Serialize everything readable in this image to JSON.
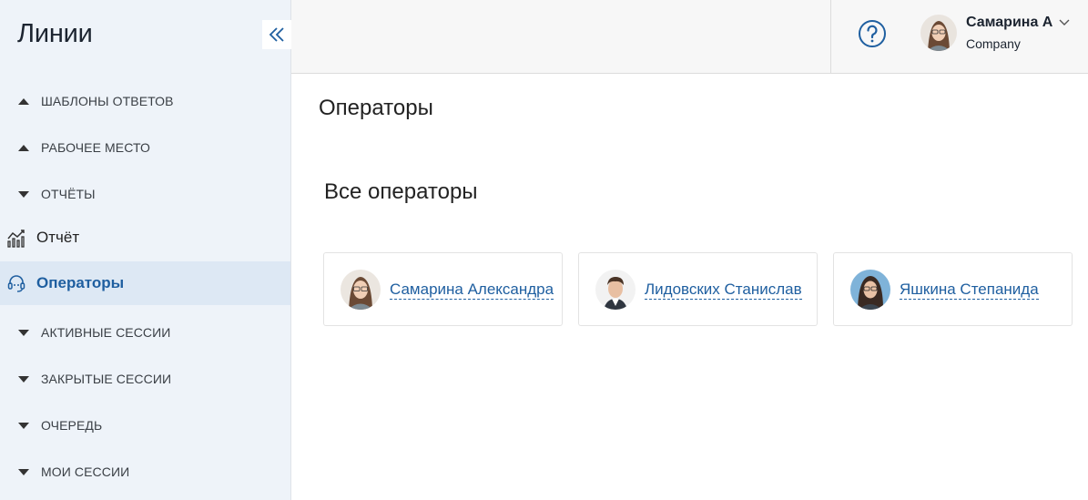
{
  "sidebar": {
    "title": "Линии",
    "sections": [
      {
        "label": "ШАБЛОНЫ ОТВЕТОВ",
        "state": "up"
      },
      {
        "label": "РАБОЧЕЕ МЕСТО",
        "state": "up"
      },
      {
        "label": "ОТЧЁТЫ",
        "state": "down"
      }
    ],
    "items": [
      {
        "label": "Отчёт",
        "icon": "chart-icon"
      },
      {
        "label": "Операторы",
        "icon": "headset-icon",
        "active": true
      }
    ],
    "sections_after": [
      {
        "label": "АКТИВНЫЕ СЕССИИ",
        "state": "down"
      },
      {
        "label": "ЗАКРЫТЫЕ СЕССИИ",
        "state": "down"
      },
      {
        "label": "ОЧЕРЕДЬ",
        "state": "down"
      },
      {
        "label": "МОИ СЕССИИ",
        "state": "down"
      }
    ]
  },
  "header": {
    "help_icon": "question-circle-icon",
    "user": {
      "name": "Самарина А",
      "company": "Company"
    }
  },
  "main": {
    "title": "Операторы",
    "section_title": "Все операторы",
    "operators": [
      {
        "name": "Самарина Александра"
      },
      {
        "name": "Лидовских Станислав"
      },
      {
        "name": "Яшкина Степанида"
      }
    ]
  },
  "colors": {
    "accent": "#1f5fa0",
    "sidebar_bg": "#eef3f9",
    "active_item_bg": "#dde8f4"
  }
}
